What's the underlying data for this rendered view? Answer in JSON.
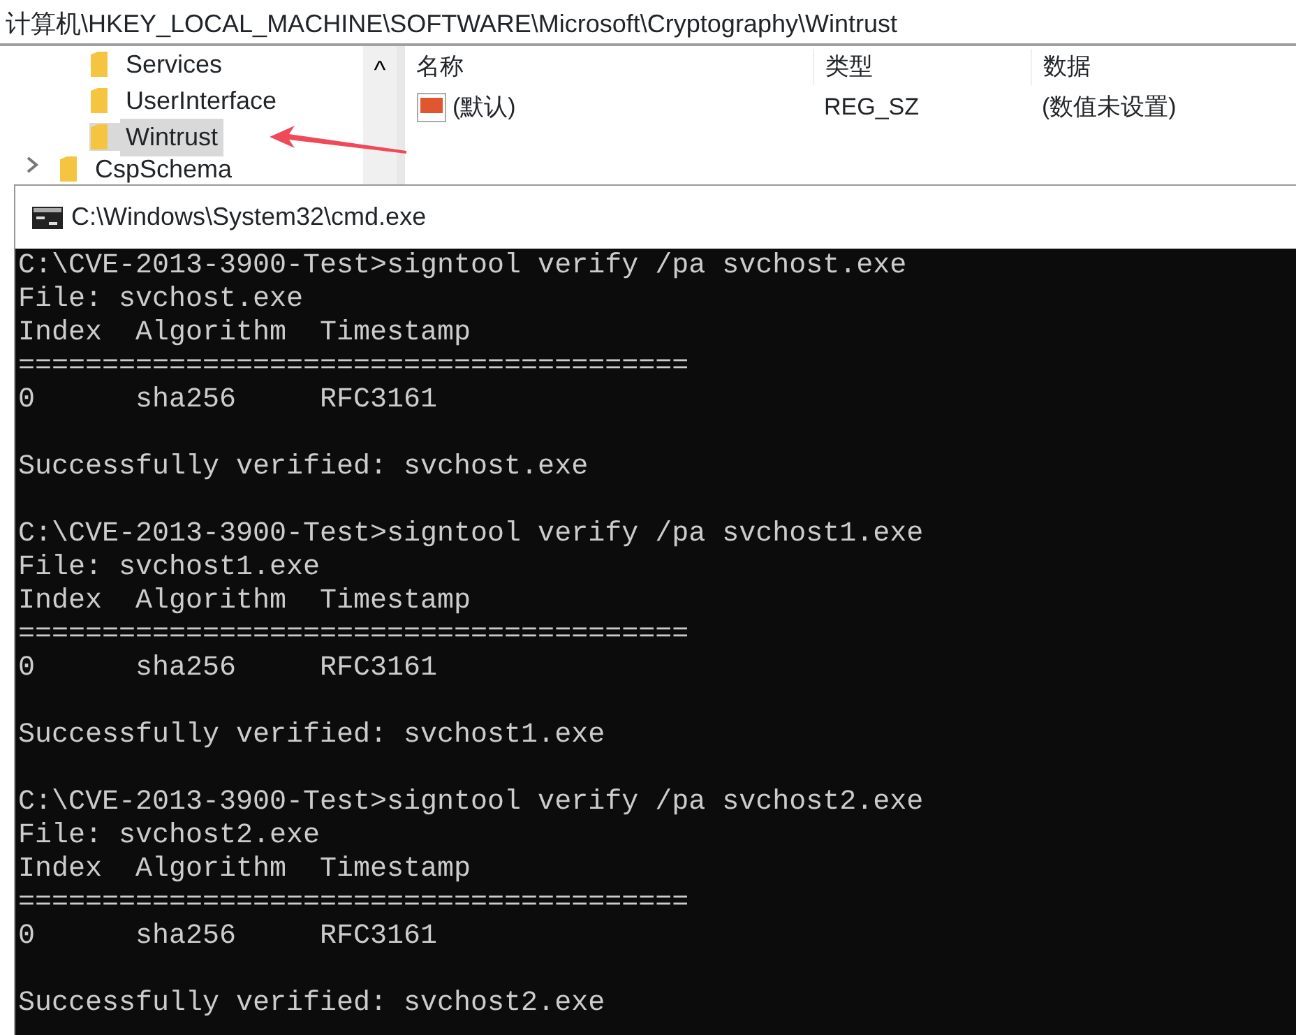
{
  "address_bar": {
    "path": "计算机\\HKEY_LOCAL_MACHINE\\SOFTWARE\\Microsoft\\Cryptography\\Wintrust"
  },
  "tree": {
    "items": [
      {
        "label": "Services",
        "selected": false,
        "expandable": false
      },
      {
        "label": "UserInterface",
        "selected": false,
        "expandable": false
      },
      {
        "label": "Wintrust",
        "selected": true,
        "expandable": false
      },
      {
        "label": "CspSchema",
        "selected": false,
        "expandable": true
      }
    ],
    "scroll_up": "^"
  },
  "values": {
    "columns": [
      "名称",
      "类型",
      "数据"
    ],
    "rows": [
      {
        "name": "(默认)",
        "type": "REG_SZ",
        "data": "(数值未设置)"
      }
    ]
  },
  "console_window": {
    "title": "C:\\Windows\\System32\\cmd.exe",
    "blocks": [
      {
        "command": "C:\\CVE-2013-3900-Test>signtool verify /pa svchost.exe",
        "lines": [
          "File: svchost.exe",
          "Index  Algorithm  Timestamp",
          "========================================",
          "0      sha256     RFC3161"
        ],
        "result": "Successfully verified: svchost.exe"
      },
      {
        "command": "C:\\CVE-2013-3900-Test>signtool verify /pa svchost1.exe",
        "lines": [
          "File: svchost1.exe",
          "Index  Algorithm  Timestamp",
          "========================================",
          "0      sha256     RFC3161"
        ],
        "result": "Successfully verified: svchost1.exe"
      },
      {
        "command": "C:\\CVE-2013-3900-Test>signtool verify /pa svchost2.exe",
        "lines": [
          "File: svchost2.exe",
          "Index  Algorithm  Timestamp",
          "========================================",
          "0      sha256     RFC3161"
        ],
        "result": "Successfully verified: svchost2.exe"
      }
    ]
  }
}
